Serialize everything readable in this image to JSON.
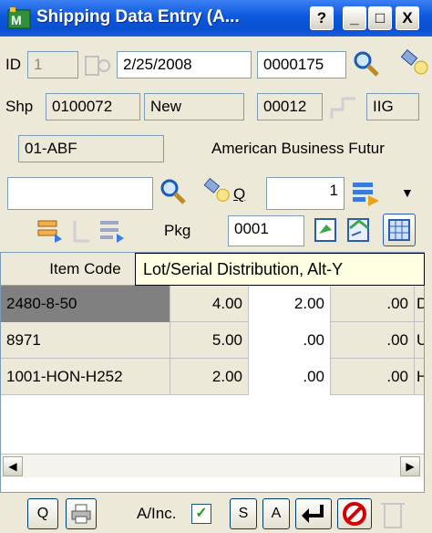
{
  "window": {
    "title": "Shipping Data Entry (A...",
    "help_btn": "?",
    "min_btn": "_",
    "max_btn": "□",
    "close_btn": "X"
  },
  "row1": {
    "id_label": "ID",
    "id_value": "1",
    "date": "2/25/2008",
    "order_no": "0000175"
  },
  "row2": {
    "shp_label": "Shp",
    "shp_value": "0100072",
    "status": "New",
    "code": "00012",
    "branch": "IIG"
  },
  "customer": {
    "code": "01-ABF",
    "name": "American Business Futur"
  },
  "row4": {
    "item_value": "",
    "q_label": "Q",
    "qty": "1"
  },
  "row5": {
    "pkg_label": "Pkg",
    "pkg_value": "0001"
  },
  "grid": {
    "headers": [
      "Item Code",
      "",
      "",
      ""
    ],
    "rows": [
      {
        "item": "2480-8-50",
        "ordered": "4.00",
        "shipped": "2.00",
        "bo": ".00",
        "extra": "D"
      },
      {
        "item": "8971",
        "ordered": "5.00",
        "shipped": ".00",
        "bo": ".00",
        "extra": "U"
      },
      {
        "item": "1001-HON-H252",
        "ordered": "2.00",
        "shipped": ".00",
        "bo": ".00",
        "extra": "H"
      }
    ]
  },
  "tooltip": "Lot/Serial Distribution, Alt-Y",
  "bottom": {
    "q_btn": "Q",
    "ainc_label": "A/Inc.",
    "s_btn": "S",
    "a_btn": "A"
  }
}
